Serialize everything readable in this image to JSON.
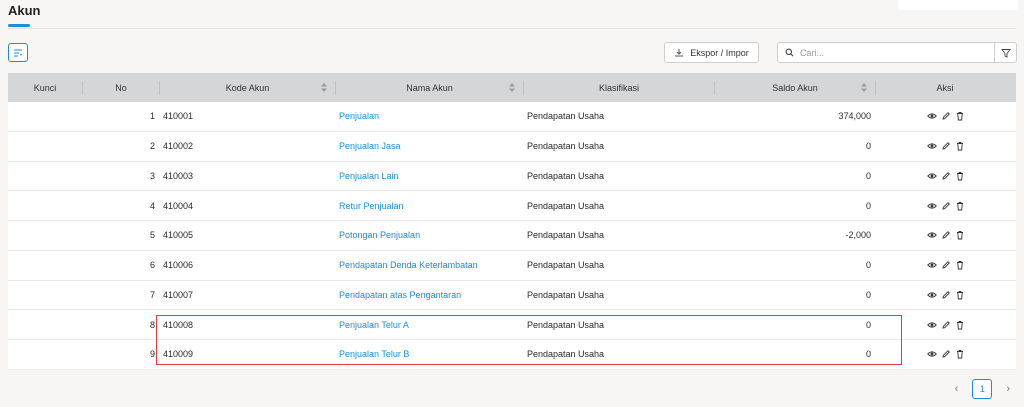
{
  "header": {
    "title": "Akun"
  },
  "toolbar": {
    "export_label": "Ekspor / Impor",
    "search_placeholder": "Cari..."
  },
  "table": {
    "columns": {
      "kunci": "Kunci",
      "no": "No",
      "kode": "Kode Akun",
      "nama": "Nama Akun",
      "klasifikasi": "Klasifikasi",
      "saldo": "Saldo Akun",
      "aksi": "Aksi"
    },
    "rows": [
      {
        "no": "1",
        "kode": "410001",
        "nama": "Penjualan",
        "klasifikasi": "Pendapatan Usaha",
        "saldo": "374,000"
      },
      {
        "no": "2",
        "kode": "410002",
        "nama": "Penjualan Jasa",
        "klasifikasi": "Pendapatan Usaha",
        "saldo": "0"
      },
      {
        "no": "3",
        "kode": "410003",
        "nama": "Penjualan Lain",
        "klasifikasi": "Pendapatan Usaha",
        "saldo": "0"
      },
      {
        "no": "4",
        "kode": "410004",
        "nama": "Retur Penjualan",
        "klasifikasi": "Pendapatan Usaha",
        "saldo": "0"
      },
      {
        "no": "5",
        "kode": "410005",
        "nama": "Potongan Penjualan",
        "klasifikasi": "Pendapatan Usaha",
        "saldo": "-2,000"
      },
      {
        "no": "6",
        "kode": "410006",
        "nama": "Pendapatan Denda Keterlambatan",
        "klasifikasi": "Pendapatan Usaha",
        "saldo": "0"
      },
      {
        "no": "7",
        "kode": "410007",
        "nama": "Pendapatan atas Pengantaran",
        "klasifikasi": "Pendapatan Usaha",
        "saldo": "0"
      },
      {
        "no": "8",
        "kode": "410008",
        "nama": "Penjualan Telur A",
        "klasifikasi": "Pendapatan Usaha",
        "saldo": "0"
      },
      {
        "no": "9",
        "kode": "410009",
        "nama": "Penjualan Telur B",
        "klasifikasi": "Pendapatan Usaha",
        "saldo": "0"
      }
    ]
  },
  "pagination": {
    "current_page": "1"
  },
  "colors": {
    "accent": "#1a8fd6",
    "highlight": "#e0393e",
    "header_bg": "#d5d6d8"
  }
}
